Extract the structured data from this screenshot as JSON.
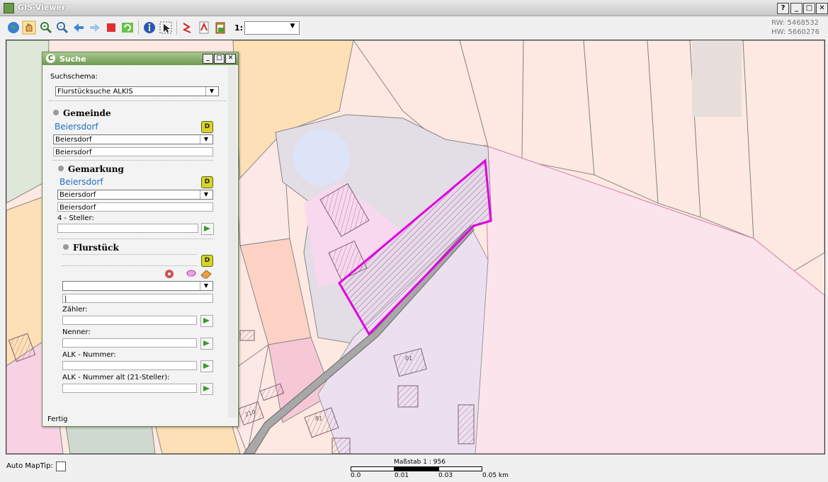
{
  "window": {
    "title": "GIS-Viewer",
    "help_label": "?",
    "minimize_label": "_",
    "maximize_label": "□",
    "close_label": "✕"
  },
  "toolbar": {
    "scale_prefix": "1:",
    "scale_value": "",
    "coords": {
      "rw": "RW: 5468532",
      "hw": "HW: 5660276"
    }
  },
  "search_dialog": {
    "title": "Suche",
    "minimize_label": "_",
    "maximize_label": "□",
    "close_label": "✕",
    "schema_label": "Suchschema:",
    "schema_value": "Flurstücksuche ALKIS",
    "gemeinde": {
      "heading": "Gemeinde",
      "selected": "Beiersdorf",
      "select_value": "Beiersdorf",
      "input_value": "Beiersdorf"
    },
    "gemarkung": {
      "heading": "Gemarkung",
      "selected": "Beiersdorf",
      "select_value": "Beiersdorf",
      "input_value": "Beiersdorf",
      "steller_label": "4 - Steller:"
    },
    "flurstueck": {
      "heading": "Flurstück",
      "zaehler_label": "Zähler:",
      "nenner_label": "Nenner:",
      "alk_label": "ALK - Nummer:",
      "alk_alt_label": "ALK - Nummer alt (21-Steller):"
    },
    "status": "Fertig"
  },
  "bottom": {
    "maptip_label": "Auto MapTip:",
    "scale_title": "Maßstab 1 : 956",
    "ticks": [
      "0.0",
      "0.01",
      "0.03",
      "0.05 km"
    ]
  },
  "map_labels": [
    "01",
    "210",
    "81"
  ],
  "colors": {
    "selection": "#e000e0",
    "parcel_fill": "#fde9e1",
    "road": "#a8a8a8"
  }
}
